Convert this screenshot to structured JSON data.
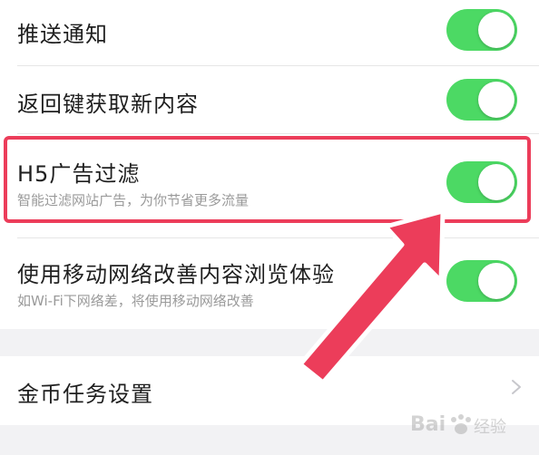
{
  "settings": {
    "push": {
      "title": "推送通知",
      "enabled": true
    },
    "back_key": {
      "title": "返回键获取新内容",
      "enabled": true
    },
    "h5_filter": {
      "title": "H5广告过滤",
      "subtitle": "智能过滤网站广告，为你节省更多流量",
      "enabled": true
    },
    "mobile_net": {
      "title": "使用移动网络改善内容浏览体验",
      "subtitle": "如Wi-Fi下网络差，将使用移动网络改善",
      "enabled": true
    },
    "coin": {
      "title": "金币任务设置"
    }
  },
  "colors": {
    "toggle_on": "#4cd964",
    "highlight": "#ec3d5a",
    "section_gap": "#f2f2f4"
  },
  "annotation": {
    "type": "highlight-with-arrow",
    "target": "h5_filter"
  },
  "watermark": {
    "text": "Bai 经验",
    "logo": "baidu-paw-icon"
  }
}
